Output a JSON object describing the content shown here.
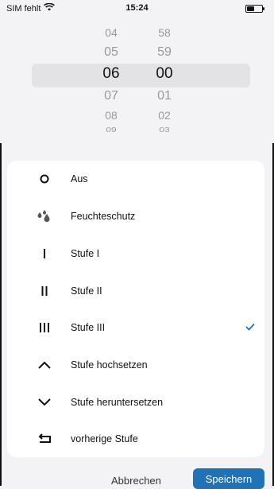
{
  "status": {
    "carrier": "SIM fehlt",
    "time": "15:24",
    "battery_level": 0.55
  },
  "picker": {
    "hours": [
      "",
      "04",
      "05",
      "06",
      "07",
      "08",
      "09",
      ""
    ],
    "minutes": [
      "",
      "58",
      "59",
      "00",
      "01",
      "02",
      "03",
      ""
    ],
    "selected_hour": "06",
    "selected_minute": "00"
  },
  "options": [
    {
      "icon": "circle-icon",
      "label": "Aus",
      "selected": false
    },
    {
      "icon": "water-drops-icon",
      "label": "Feuchteschutz",
      "selected": false
    },
    {
      "icon": "level-1-icon",
      "label": "Stufe I",
      "selected": false
    },
    {
      "icon": "level-2-icon",
      "label": "Stufe II",
      "selected": false
    },
    {
      "icon": "level-3-icon",
      "label": "Stufe III",
      "selected": true
    },
    {
      "icon": "chevron-up-icon",
      "label": "Stufe hochsetzen",
      "selected": false
    },
    {
      "icon": "chevron-down-icon",
      "label": "Stufe heruntersetzen",
      "selected": false
    },
    {
      "icon": "return-icon",
      "label": "vorherige Stufe",
      "selected": false
    }
  ],
  "footer": {
    "cancel_label": "Abbrechen",
    "save_label": "Speichern"
  },
  "colors": {
    "accent": "#1f72b5",
    "check": "#1f72b5",
    "highlight": "#e3e3e6"
  }
}
